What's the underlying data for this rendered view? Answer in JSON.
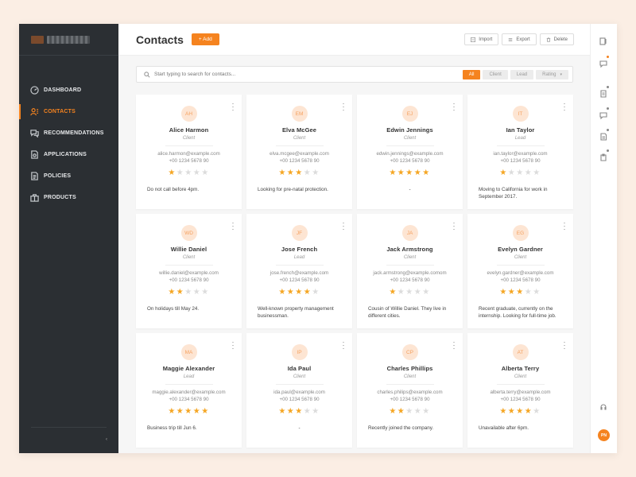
{
  "sidebar": {
    "items": [
      {
        "label": "DASHBOARD",
        "icon": "dashboard-icon",
        "active": false
      },
      {
        "label": "CONTACTS",
        "icon": "contacts-icon",
        "active": true
      },
      {
        "label": "RECOMMENDATIONS",
        "icon": "recommendations-icon",
        "active": false
      },
      {
        "label": "APPLICATIONS",
        "icon": "applications-icon",
        "active": false
      },
      {
        "label": "POLICIES",
        "icon": "policies-icon",
        "active": false
      },
      {
        "label": "PRODUCTS",
        "icon": "products-icon",
        "active": false
      }
    ],
    "collapse_glyph": "‹"
  },
  "header": {
    "title": "Contacts",
    "add_label": "+ Add",
    "import_label": "Import",
    "export_label": "Export",
    "delete_label": "Delete"
  },
  "search": {
    "placeholder": "Start typing to search for contacts...",
    "filters": [
      {
        "label": "All",
        "active": true
      },
      {
        "label": "Client",
        "active": false
      },
      {
        "label": "Lead",
        "active": false
      },
      {
        "label": "Rating",
        "active": false,
        "dropdown": true
      }
    ]
  },
  "contacts": [
    {
      "initials": "AH",
      "name": "Alice Harmon",
      "role": "Client",
      "email": "alice.harmon@example.com",
      "phone": "+00 1234 5678 90",
      "rating": 1,
      "note": "Do not call before 4pm."
    },
    {
      "initials": "EM",
      "name": "Elva McGee",
      "role": "Client",
      "email": "elva.mcgee@example.com",
      "phone": "+00 1234 5678 90",
      "rating": 3,
      "note": "Looking for pre-natal protection."
    },
    {
      "initials": "EJ",
      "name": "Edwin Jennings",
      "role": "Client",
      "email": "edwin.jennings@example.com",
      "phone": "+00 1234 5678 90",
      "rating": 5,
      "note": "-"
    },
    {
      "initials": "IT",
      "name": "Ian Taylor",
      "role": "Lead",
      "email": "ian.taylor@example.com",
      "phone": "+00 1234 5678 90",
      "rating": 1,
      "note": "Moving to California for work in September 2017."
    },
    {
      "initials": "WD",
      "name": "Willie Daniel",
      "role": "Client",
      "email": "willie.daniel@example.com",
      "phone": "+00 1234 5678 90",
      "rating": 2,
      "note": "On holidays till May 24."
    },
    {
      "initials": "JF",
      "name": "Jose French",
      "role": "Lead",
      "email": "jose.french@example.com",
      "phone": "+00 1234 5678 90",
      "rating": 4,
      "note": "Well-known property management businessman."
    },
    {
      "initials": "JA",
      "name": "Jack Armstrong",
      "role": "Client",
      "email": "jack.armstrong@example.comom",
      "phone": "+00 1234 5678 90",
      "rating": 1,
      "note": "Cousin of Willie Daniel. They live in different cities."
    },
    {
      "initials": "EG",
      "name": "Evelyn Gardner",
      "role": "Client",
      "email": "evelyn.gardner@example.com",
      "phone": "+00 1234 5678 90",
      "rating": 3,
      "note": "Recent graduate, currently on the internship. Looking for full-time job."
    },
    {
      "initials": "MA",
      "name": "Maggie Alexander",
      "role": "Lead",
      "email": "maggie.alexander@example.com",
      "phone": "+00 1234 5678 90",
      "rating": 5,
      "note": "Business trip till Jun 6."
    },
    {
      "initials": "IP",
      "name": "Ida Paul",
      "role": "Client",
      "email": "ida.paul@example.com",
      "phone": "+00 1234 5678 90",
      "rating": 3,
      "note": "-"
    },
    {
      "initials": "CP",
      "name": "Charles Phillips",
      "role": "Client",
      "email": "charles.philips@example.com",
      "phone": "+00 1234 5678 90",
      "rating": 2,
      "note": "Recently joined the company."
    },
    {
      "initials": "AT",
      "name": "Alberta Terry",
      "role": "Client",
      "email": "alberta.terry@example.com",
      "phone": "+00 1234 5678 90",
      "rating": 4,
      "note": "Unavailable after 6pm."
    }
  ],
  "rail": {
    "icons": [
      "contacts-icon",
      "chat-icon",
      "notes-icon",
      "messages-icon",
      "document-icon",
      "clipboard-icon",
      "support-icon"
    ],
    "user_initials": "PN"
  },
  "colors": {
    "accent": "#f5831f",
    "sidebar": "#2b2f33",
    "star": "#f5a623"
  }
}
